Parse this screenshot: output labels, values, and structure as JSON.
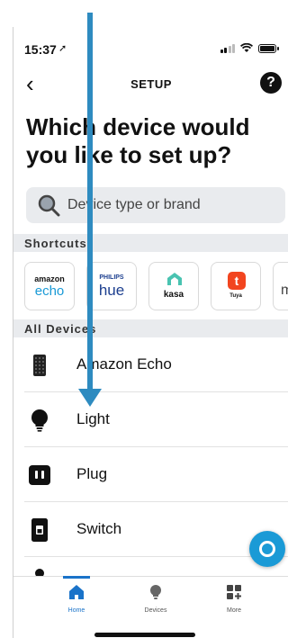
{
  "caption": "",
  "status": {
    "time": "15:37"
  },
  "header": {
    "title": "SETUP",
    "back": "‹",
    "help": "?"
  },
  "headline": "Which device would you like to set up?",
  "search": {
    "placeholder": "Device type or brand"
  },
  "shortcuts": {
    "label": "Shortcuts",
    "items": [
      {
        "brand": "amazon echo",
        "line1": "amazon",
        "line2": "echo"
      },
      {
        "brand": "philips hue",
        "line1": "PHILIPS",
        "line2": "hue"
      },
      {
        "brand": "kasa",
        "line1": "kasa"
      },
      {
        "brand": "tuya",
        "line1": "Tuya"
      },
      {
        "brand": "partial",
        "line1": "m"
      }
    ]
  },
  "all_devices": {
    "label": "All Devices",
    "items": [
      {
        "label": "Amazon Echo",
        "icon": "echo-speaker-icon"
      },
      {
        "label": "Light",
        "icon": "light-bulb-icon"
      },
      {
        "label": "Plug",
        "icon": "plug-icon"
      },
      {
        "label": "Switch",
        "icon": "switch-icon"
      }
    ]
  },
  "tabs": [
    {
      "label": "Home",
      "icon": "home-icon",
      "active": true
    },
    {
      "label": "Devices",
      "icon": "bulb-icon",
      "active": false
    },
    {
      "label": "More",
      "icon": "grid-plus-icon",
      "active": false
    }
  ],
  "colors": {
    "accent": "#1a73c9",
    "arrow": "#2e8bc0",
    "fab": "#1a9ad6",
    "section_bg": "#e9ebee"
  }
}
